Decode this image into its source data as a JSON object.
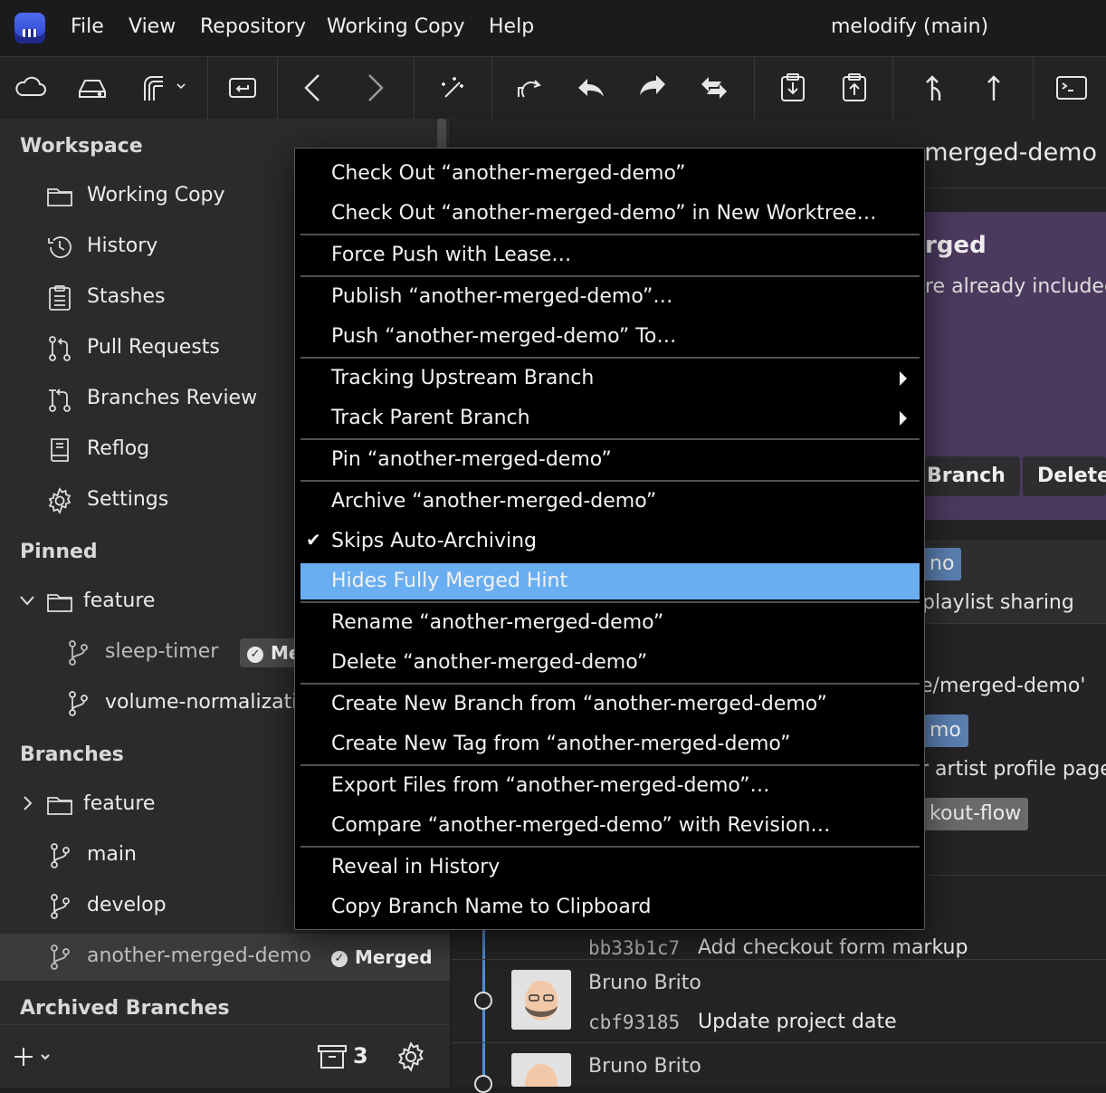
{
  "menubar": {
    "items": [
      "File",
      "View",
      "Repository",
      "Working Copy",
      "Help"
    ],
    "window_title": "melodify (main)"
  },
  "toolbar": {
    "buttons": [
      "cloud-icon",
      "drive-icon",
      "remote-icon",
      "checkout-icon",
      "back-icon",
      "forward-icon",
      "magic-icon",
      "push-pull-icon",
      "undo-icon",
      "redo-icon",
      "sync-icon",
      "stash-save-icon",
      "stash-apply-icon",
      "merge-icon",
      "push-up-icon",
      "terminal-icon"
    ]
  },
  "sidebar": {
    "workspace_title": "Workspace",
    "workspace_items": [
      {
        "label": "Working Copy",
        "icon": "folder-icon"
      },
      {
        "label": "History",
        "icon": "history-icon"
      },
      {
        "label": "Stashes",
        "icon": "clipboard-icon"
      },
      {
        "label": "Pull Requests",
        "icon": "pull-request-icon"
      },
      {
        "label": "Branches Review",
        "icon": "branches-review-icon"
      },
      {
        "label": "Reflog",
        "icon": "book-icon"
      },
      {
        "label": "Settings",
        "icon": "gear-icon"
      }
    ],
    "pinned_title": "Pinned",
    "pinned_folder": "feature",
    "pinned_branches": [
      {
        "label": "sleep-timer",
        "badge": "Me"
      },
      {
        "label": "volume-normalizati"
      }
    ],
    "branches_title": "Branches",
    "branches_folder": "feature",
    "branches": [
      "main",
      "develop",
      "another-merged-demo"
    ],
    "selected_badge": "Merged",
    "archived_title": "Archived Branches",
    "archive_count": "3"
  },
  "main": {
    "header_fragment": "-merged-demo",
    "banner_title": "rged",
    "banner_text": "re already included",
    "banner_buttons": [
      "Branch",
      "Delete"
    ],
    "fragments": {
      "chip1": "no",
      "line1": "playlist sharing",
      "line2": "e/merged-demo'",
      "chip2": "mo",
      "line3": "r artist profile page",
      "chip3": "kout-flow"
    },
    "commits": [
      {
        "author": "",
        "hash": "bb33b1c7",
        "message": "Add checkout form markup"
      },
      {
        "author": "Bruno Brito",
        "hash": "cbf93185",
        "message": "Update project date"
      },
      {
        "author": "Bruno Brito",
        "hash": "",
        "message": ""
      }
    ]
  },
  "context_menu": {
    "items": [
      "Check Out “another-merged-demo”",
      "Check Out  “another-merged-demo” in New Worktree…",
      "Force Push with Lease…",
      "Publish “another-merged-demo”…",
      "Push “another-merged-demo” To…",
      "Tracking Upstream Branch",
      "Track Parent Branch",
      "Pin “another-merged-demo”",
      "Archive “another-merged-demo”",
      "Skips Auto-Archiving",
      "Hides Fully Merged Hint",
      "Rename “another-merged-demo”",
      "Delete “another-merged-demo”",
      "Create New Branch from “another-merged-demo”",
      "Create New Tag from “another-merged-demo”",
      "Export Files from “another-merged-demo”…",
      "Compare “another-merged-demo” with Revision…",
      "Reveal in History",
      "Copy Branch Name to Clipboard"
    ],
    "checked_item": "Skips Auto-Archiving",
    "highlighted_item": "Hides Fully Merged Hint",
    "highlight_color": "#6aaef2"
  }
}
